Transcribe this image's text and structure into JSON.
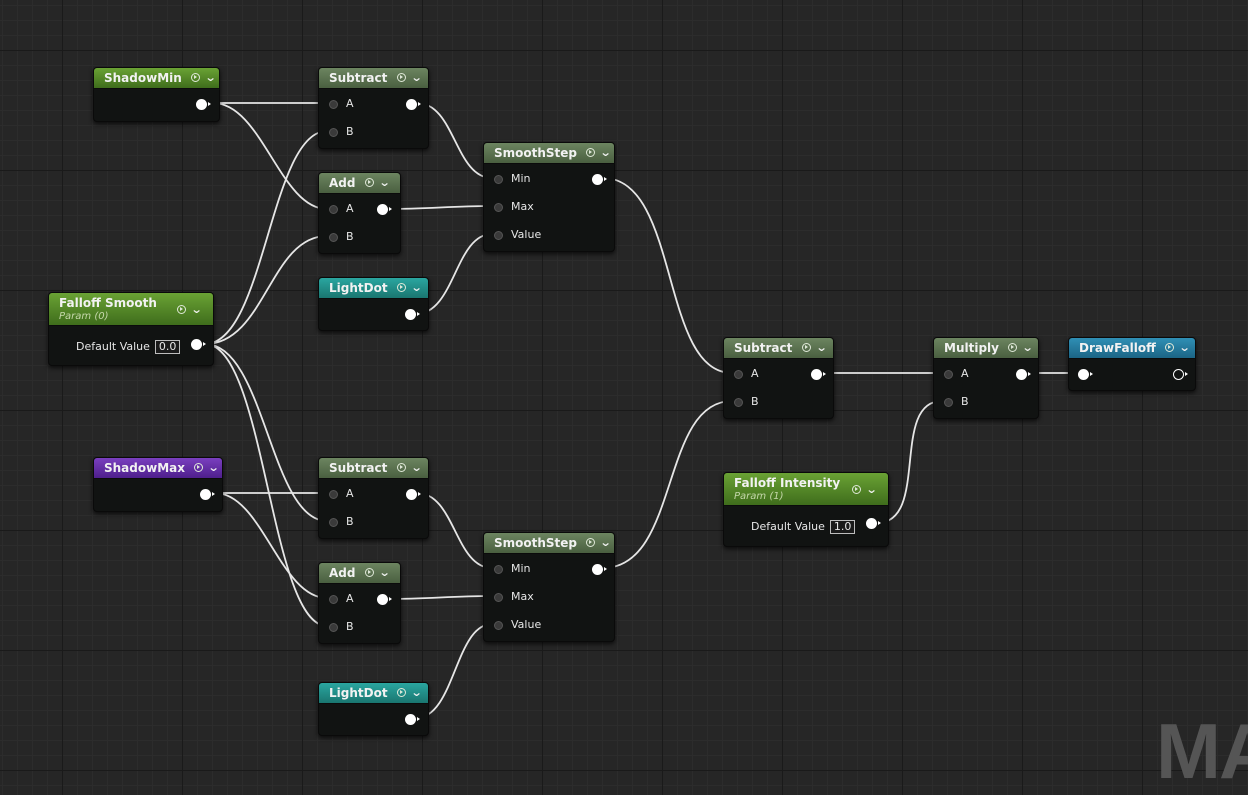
{
  "nodes": {
    "shadow_min": {
      "title": "ShadowMin"
    },
    "subtract_1": {
      "title": "Subtract",
      "in_a": "A",
      "in_b": "B"
    },
    "add_1": {
      "title": "Add",
      "in_a": "A",
      "in_b": "B"
    },
    "smoothstep_1": {
      "title": "SmoothStep",
      "in_min": "Min",
      "in_max": "Max",
      "in_value": "Value"
    },
    "lightdot_1": {
      "title": "LightDot"
    },
    "falloff_smooth": {
      "title": "Falloff Smooth",
      "subtitle": "Param (0)",
      "default_label": "Default Value",
      "default_value": "0.0"
    },
    "subtract_3": {
      "title": "Subtract",
      "in_a": "A",
      "in_b": "B"
    },
    "multiply": {
      "title": "Multiply",
      "in_a": "A",
      "in_b": "B"
    },
    "draw_falloff": {
      "title": "DrawFalloff"
    },
    "shadow_max": {
      "title": "ShadowMax"
    },
    "subtract_2": {
      "title": "Subtract",
      "in_a": "A",
      "in_b": "B"
    },
    "falloff_intensity": {
      "title": "Falloff Intensity",
      "subtitle": "Param (1)",
      "default_label": "Default Value",
      "default_value": "1.0"
    },
    "add_2": {
      "title": "Add",
      "in_a": "A",
      "in_b": "B"
    },
    "smoothstep_2": {
      "title": "SmoothStep",
      "in_min": "Min",
      "in_max": "Max",
      "in_value": "Value"
    },
    "lightdot_2": {
      "title": "LightDot"
    }
  },
  "watermark": "MA",
  "colors": {
    "canvas": "#262626",
    "op_header": "#5b7350",
    "param_green": "#5a8f2a",
    "param_purple": "#6531a8",
    "param_teal": "#22908a",
    "param_blue": "#25779c",
    "wire": "#e6e6e6"
  },
  "icons": {
    "preview": "preview-toggle-icon",
    "collapse": "chevron-down-icon"
  }
}
